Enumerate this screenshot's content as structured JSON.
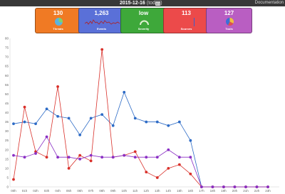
{
  "header": {
    "date": "2015-12-16",
    "today_label": "(today)",
    "user_label": "Documentation"
  },
  "tiles": [
    {
      "value": "130",
      "label": "Threats",
      "color": "#f07a24",
      "mini": "pie"
    },
    {
      "value": "1,263",
      "label": "Events",
      "color": "#5a70d8",
      "mini": "spark"
    },
    {
      "value": "low",
      "label": "Severity",
      "color": "#3ea83a",
      "mini": "gauge"
    },
    {
      "value": "113",
      "label": "Sources",
      "color": "#ec4a4a",
      "mini": "bar"
    },
    {
      "value": "127",
      "label": "Tools",
      "color": "#b95ec2",
      "mini": "pie"
    }
  ],
  "chart_data": {
    "type": "line",
    "categories": [
      "00h",
      "01h",
      "02h",
      "03h",
      "04h",
      "05h",
      "06h",
      "07h",
      "08h",
      "09h",
      "10h",
      "11h",
      "12h",
      "13h",
      "14h",
      "15h",
      "16h",
      "17h",
      "18h",
      "19h",
      "20h",
      "21h",
      "22h",
      "23h"
    ],
    "ylim": [
      0,
      80
    ],
    "yticks": [
      "0",
      "5",
      "10",
      "15",
      "20",
      "25",
      "30",
      "35",
      "40",
      "45",
      "50",
      "55",
      "60",
      "65",
      "70",
      "75",
      "80"
    ],
    "grid": false,
    "series": [
      {
        "color": "#2d6bc6",
        "values": [
          34,
          35,
          34,
          42,
          38,
          37,
          28,
          37,
          39,
          33,
          51,
          37,
          35,
          35,
          33,
          35,
          25,
          0,
          0,
          0,
          0,
          0,
          0,
          0
        ]
      },
      {
        "color": "#d9302a",
        "values": [
          4,
          43,
          19,
          16,
          54,
          10,
          17,
          14,
          74,
          16,
          17,
          19,
          8,
          5,
          10,
          12,
          7,
          0,
          0,
          0,
          0,
          0,
          0,
          0
        ]
      },
      {
        "color": "#8a2fc4",
        "values": [
          17,
          16,
          18,
          27,
          16,
          16,
          15,
          17,
          16,
          16,
          17,
          16,
          16,
          16,
          20,
          16,
          16,
          0,
          0,
          0,
          0,
          0,
          0,
          0
        ]
      }
    ]
  }
}
